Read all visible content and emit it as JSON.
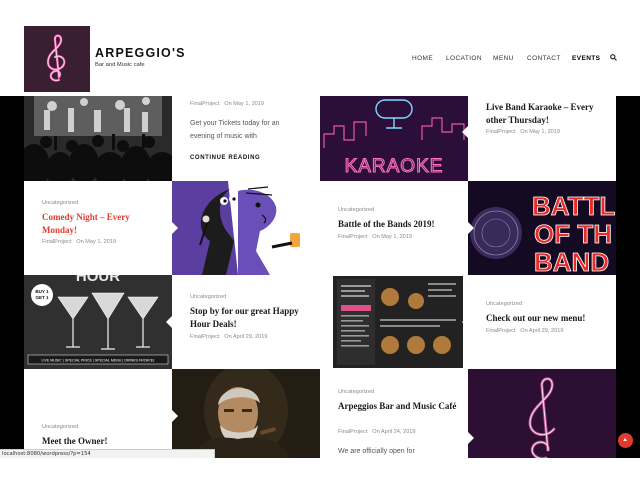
{
  "brand": {
    "name": "ARPEGGIO'S",
    "tagline": "Bar and Music cafe"
  },
  "nav": {
    "home": "HOME",
    "location": "LOCATION",
    "menu": "MENU",
    "contact": "CONTACT",
    "events": "EVENTS",
    "search_icon": "search-icon"
  },
  "posts": {
    "p1": {
      "meta_author": "FinalProject",
      "meta_date": "On May 1, 2019",
      "excerpt": "Get your Tickets today for an evening of music with",
      "more": "CONTINUE READING"
    },
    "p2": {
      "title": "Live Band Karaoke – Every other Thursday!",
      "meta_author": "FinalProject",
      "meta_date": "On May 1, 2019",
      "image_text": "KARAOKE"
    },
    "p3": {
      "category": "Uncategorized",
      "title": "Comedy Night – Every Monday!",
      "meta_author": "FinalProject",
      "meta_date": "On May 1, 2019"
    },
    "p4": {
      "category": "Uncategorized",
      "title": "Battle of the Bands 2019!",
      "meta_author": "FinalProject",
      "meta_date": "On May 1, 2019",
      "image_text_1": "BATTL",
      "image_text_2": "OF TH",
      "image_text_3": "BAND"
    },
    "p5": {
      "category": "Uncategorized",
      "title": "Stop by for our great Happy Hour Deals!",
      "meta_author": "FinalProject",
      "meta_date": "On April 29, 2019",
      "image_text": "HOUR",
      "badge": "BUY 1 GET 1",
      "strip": "LIVE MUSIC | SPECIAL PRICE | SPECIAL MENU | DRINKS FROM $1"
    },
    "p6": {
      "category": "Uncategorized",
      "title": "Check out our new menu!",
      "meta_author": "FinalProject",
      "meta_date": "On April 29, 2019"
    },
    "p7": {
      "category": "Uncategorized",
      "title": "Meet the Owner!"
    },
    "p8": {
      "category": "Uncategorized",
      "title": "Arpeggios Bar and Music Café",
      "meta_author": "FinalProject",
      "meta_date": "On April 24, 2019",
      "excerpt": "We are officially open for"
    }
  },
  "statusbar": {
    "url": "localhost:8080/wordpress/?p=154"
  },
  "colors": {
    "accent": "#e23a2e",
    "purple": "#5b3fa0",
    "neon_pink": "#ff4fa3"
  }
}
